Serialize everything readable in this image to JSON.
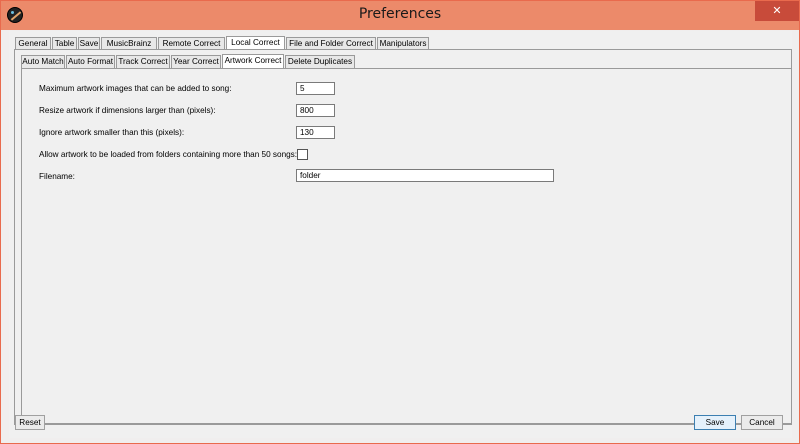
{
  "window": {
    "title": "Preferences",
    "close_glyph": "✕"
  },
  "main_tabs": [
    {
      "label": "General"
    },
    {
      "label": "Table"
    },
    {
      "label": "Save"
    },
    {
      "label": "MusicBrainz"
    },
    {
      "label": "Remote Correct"
    },
    {
      "label": "Local Correct"
    },
    {
      "label": "File and Folder Correct"
    },
    {
      "label": "Manipulators"
    }
  ],
  "main_tab_selected": "Local Correct",
  "sub_tabs": [
    {
      "label": "Auto Match"
    },
    {
      "label": "Auto Format"
    },
    {
      "label": "Track Correct"
    },
    {
      "label": "Year Correct"
    },
    {
      "label": "Artwork Correct"
    },
    {
      "label": "Delete Duplicates"
    }
  ],
  "sub_tab_selected": "Artwork Correct",
  "form": {
    "max_images_label": "Maximum artwork images that can be added to song:",
    "max_images_value": "5",
    "resize_label": "Resize artwork if dimensions larger than (pixels):",
    "resize_value": "800",
    "ignore_label": "Ignore artwork smaller than this (pixels):",
    "ignore_value": "130",
    "allow_folders_label": "Allow artwork to be loaded from folders containing more than 50 songs:",
    "allow_folders_checked": false,
    "filename_label": "Filename:",
    "filename_value": "folder"
  },
  "buttons": {
    "reset": "Reset",
    "save": "Save",
    "cancel": "Cancel"
  },
  "colors": {
    "titlebar": "#ec8a6a",
    "close": "#c84b3a",
    "border": "#e96a4d"
  }
}
